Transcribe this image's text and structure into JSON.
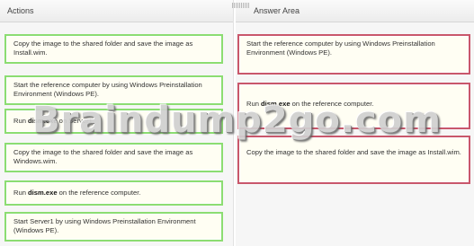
{
  "actions": {
    "header": "Actions",
    "items": [
      {
        "pre": "Copy the image to the shared folder and save the image as Install.wim.",
        "bold": "",
        "post": ""
      },
      {
        "pre": "Start the reference computer by using Windows Preinstallation Environment (Windows PE).",
        "bold": "",
        "post": ""
      },
      {
        "pre": "Run ",
        "bold": "dism.exe",
        "post": " on Server1."
      },
      {
        "pre": "Copy the image to the shared folder and save the image as Windows.wim.",
        "bold": "",
        "post": ""
      },
      {
        "pre": "Run ",
        "bold": "dism.exe",
        "post": " on the reference computer."
      },
      {
        "pre": "Start Server1 by using Windows Preinstallation Environment (Windows PE).",
        "bold": "",
        "post": ""
      }
    ]
  },
  "answer_area": {
    "header": "Answer Area",
    "items": [
      {
        "pre": "Start the reference computer by using Windows Preinstallation Environment (Windows PE).",
        "bold": "",
        "post": ""
      },
      {
        "pre": "Run ",
        "bold": "dism.exe",
        "post": " on the reference computer."
      },
      {
        "pre": "Copy the image to the shared folder and save the image as Install.wim.",
        "bold": "",
        "post": ""
      }
    ]
  },
  "watermark": "Braindump2go.com",
  "colors": {
    "action_border": "#8cdd72",
    "answer_border": "#c9576b"
  }
}
